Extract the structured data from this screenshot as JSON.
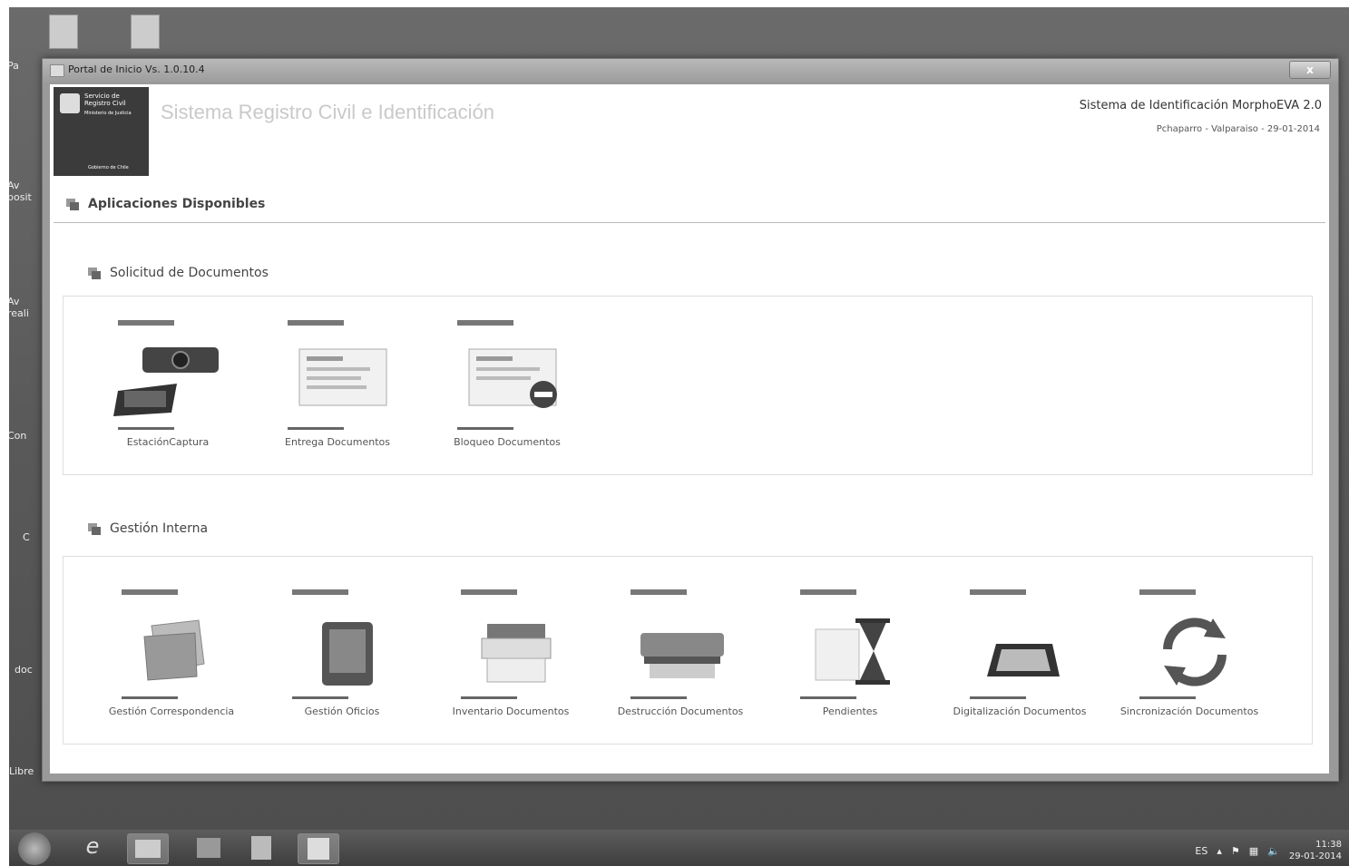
{
  "desktop": {
    "icons": [
      {
        "label": "Pa",
        "icon": "recycle-bin-icon"
      },
      {
        "label": "Av\nposit",
        "icon": "shortcut-icon"
      },
      {
        "label": "Av\nreali",
        "icon": "shortcut-icon"
      },
      {
        "label": "Con",
        "icon": "shortcut-icon"
      },
      {
        "label": "C",
        "icon": "shortcut-icon"
      },
      {
        "label": "doc",
        "icon": "shortcut-icon"
      },
      {
        "label": "Libre",
        "icon": "shortcut-icon"
      }
    ]
  },
  "window": {
    "title": "Portal de Inicio Vs. 1.0.10.4",
    "close_label": "x"
  },
  "header": {
    "logo": {
      "line1": "Servicio de Registro Civil",
      "line2": "Ministerio de Justicia",
      "line3": "Gobierno de Chile"
    },
    "app_title": "Sistema Registro Civil e Identificación",
    "system_name": "Sistema de Identificación MorphoEVA 2.0",
    "user_info": "Pchaparro - Valparaiso - 29-01-2014"
  },
  "main": {
    "section_title": "Aplicaciones Disponibles",
    "groups": [
      {
        "title": "Solicitud de Documentos",
        "apps": [
          {
            "label": "EstaciónCaptura",
            "icon": "camera-signature-pad-icon"
          },
          {
            "label": "Entrega Documentos",
            "icon": "document-icon"
          },
          {
            "label": "Bloqueo Documentos",
            "icon": "document-blocked-icon"
          }
        ]
      },
      {
        "title": "Gestión Interna",
        "apps": [
          {
            "label": "Gestión Correspondencia",
            "icon": "envelopes-icon"
          },
          {
            "label": "Gestión Oficios",
            "icon": "inbox-tray-icon"
          },
          {
            "label": "Inventario Documentos",
            "icon": "printer-icon"
          },
          {
            "label": "Destrucción Documentos",
            "icon": "shredder-icon"
          },
          {
            "label": "Pendientes",
            "icon": "hourglass-icon"
          },
          {
            "label": "Digitalización Documentos",
            "icon": "scanner-icon"
          },
          {
            "label": "Sincronización Documentos",
            "icon": "sync-icon"
          }
        ]
      }
    ]
  },
  "taskbar": {
    "language": "ES",
    "time": "11:38",
    "date": "29-01-2014"
  }
}
